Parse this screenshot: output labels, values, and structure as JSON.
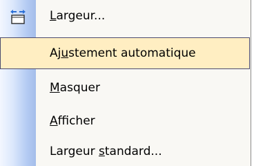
{
  "menu": {
    "items": [
      {
        "pre": "",
        "acc": "L",
        "post": "argeur...",
        "icon": "column-width-icon",
        "highlighted": false
      },
      {
        "pre": "Aj",
        "acc": "u",
        "post": "stement automatique",
        "icon": "",
        "highlighted": true
      },
      {
        "pre": "",
        "acc": "M",
        "post": "asquer",
        "icon": "",
        "highlighted": false
      },
      {
        "pre": "",
        "acc": "A",
        "post": "fficher",
        "icon": "",
        "highlighted": false
      },
      {
        "pre": "Largeur ",
        "acc": "s",
        "post": "tandard...",
        "icon": "",
        "highlighted": false
      }
    ]
  },
  "colors": {
    "highlight_bg": "#ffeec2",
    "highlight_border": "#4b4b6f",
    "gutter_light": "#dce8fc",
    "gutter_dark": "#a4bdea"
  }
}
